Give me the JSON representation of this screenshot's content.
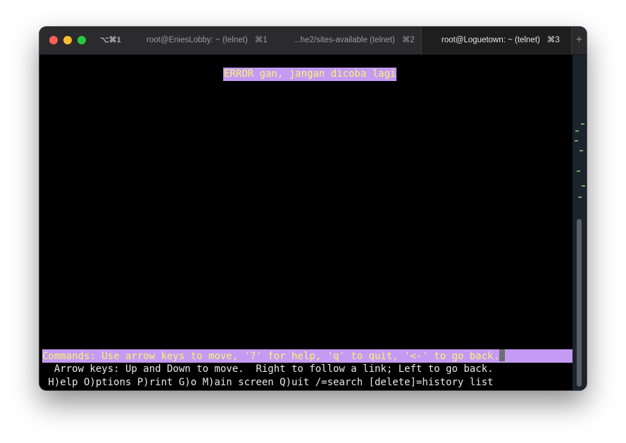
{
  "titlebar": {
    "window_shortcut": "⌥⌘1",
    "tabs": [
      {
        "label": "root@EniesLobby: ~ (telnet)",
        "shortcut": "⌘1"
      },
      {
        "label": "...he2/sites-available (telnet)",
        "shortcut": "⌘2"
      },
      {
        "label": "root@Loguetown: ~ (telnet)",
        "shortcut": "⌘3"
      }
    ],
    "add_tab_label": "+"
  },
  "terminal": {
    "error_message": "ERROR gan, jangan dicoba lagi",
    "command_line": "Commands: Use arrow keys to move, '?' for help, 'q' to quit, '<-' to go back.",
    "hint_line_1": "  Arrow keys: Up and Down to move.  Right to follow a link; Left to go back.",
    "hint_line_2": " H)elp O)ptions P)rint G)o M)ain screen Q)uit /=search [delete]=history list"
  },
  "colors": {
    "highlight_bg": "#c49af5",
    "highlight_fg": "#f9f56b",
    "terminal_bg": "#000000",
    "terminal_fg": "#e8e8e8"
  }
}
